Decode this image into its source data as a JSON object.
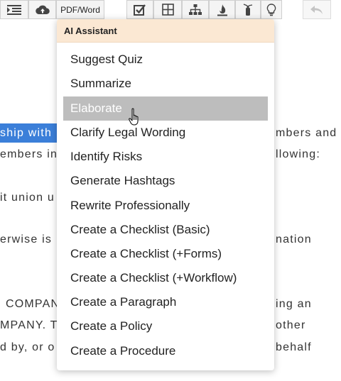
{
  "toolbar": {
    "pdf_word_label": "PDF/Word",
    "icons": [
      "indent-icon",
      "cloud-upload-icon",
      "checkbox-icon",
      "table-icon",
      "sitemap-icon",
      "fire-icon",
      "extinguisher-icon",
      "lightbulb-icon",
      "undo-icon"
    ]
  },
  "document": {
    "selected_text": "ship with",
    "lines": [
      {
        "left": "ship with",
        "right": "mbers and"
      },
      {
        "left": "embers in",
        "right": "llowing:"
      },
      {
        "left": "it union u",
        "right": ""
      },
      {
        "left": "erwise is",
        "right": "nation"
      },
      {
        "left": "COMPAN",
        "right": "ing an"
      },
      {
        "left": "MPANY. T",
        "right": "other"
      },
      {
        "left": "d by, or o",
        "right": "behalf"
      }
    ]
  },
  "menu": {
    "header": "AI Assistant",
    "items": [
      "Suggest Quiz",
      "Summarize",
      "Elaborate",
      "Clarify Legal Wording",
      "Identify Risks",
      "Generate Hashtags",
      "Rewrite Professionally",
      "Create a Checklist (Basic)",
      "Create a Checklist (+Forms)",
      "Create a Checklist (+Workflow)",
      "Create a Paragraph",
      "Create a Policy",
      "Create a Procedure"
    ],
    "active_index": 2
  },
  "colors": {
    "selection": "#3b7fd9",
    "menu_header_bg": "#fbe8d3",
    "menu_hover": "#bdbdbd"
  }
}
